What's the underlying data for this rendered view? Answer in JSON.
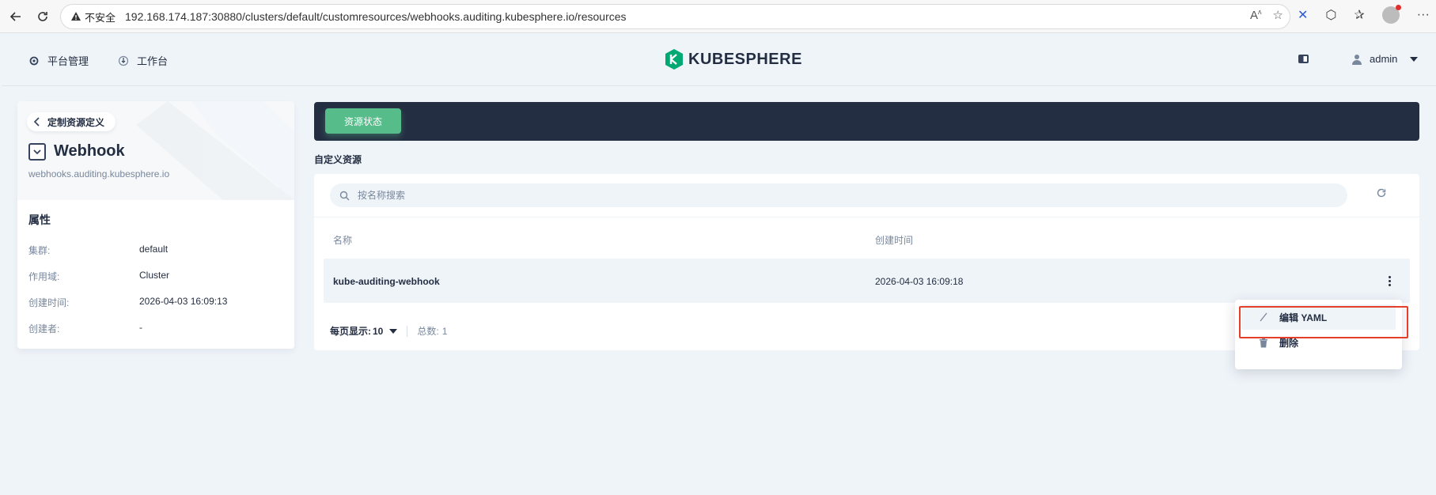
{
  "browser": {
    "insecure_label": "不安全",
    "url": "192.168.174.187:30880/clusters/default/customresources/webhooks.auditing.kubesphere.io/resources"
  },
  "header": {
    "platform_label": "平台管理",
    "workbench_label": "工作台",
    "logo_text": "KUBESPHERE",
    "user_name": "admin"
  },
  "sidebar": {
    "back_label": "定制资源定义",
    "title": "Webhook",
    "subtitle": "webhooks.auditing.kubesphere.io",
    "props_title": "属性",
    "properties": [
      {
        "key": "集群:",
        "value": "default"
      },
      {
        "key": "作用域:",
        "value": "Cluster"
      },
      {
        "key": "创建时间:",
        "value": "2026-04-03 16:09:13"
      },
      {
        "key": "创建者:",
        "value": "-"
      }
    ]
  },
  "main": {
    "status_button": "资源状态",
    "section_label": "自定义资源",
    "search_placeholder": "按名称搜索",
    "columns": [
      "名称",
      "创建时间"
    ],
    "rows": [
      {
        "name": "kube-auditing-webhook",
        "created": "2026-04-03 16:09:18"
      }
    ],
    "pager": {
      "per_page_label": "每页显示:",
      "per_page_value": "10",
      "total_label": "总数:",
      "total_value": "1"
    }
  },
  "dropdown": {
    "items": [
      "编辑 YAML",
      "删除"
    ]
  },
  "colors": {
    "accent": "#55bc8a",
    "banner": "#242e42",
    "highlight": "#e53e2b"
  }
}
